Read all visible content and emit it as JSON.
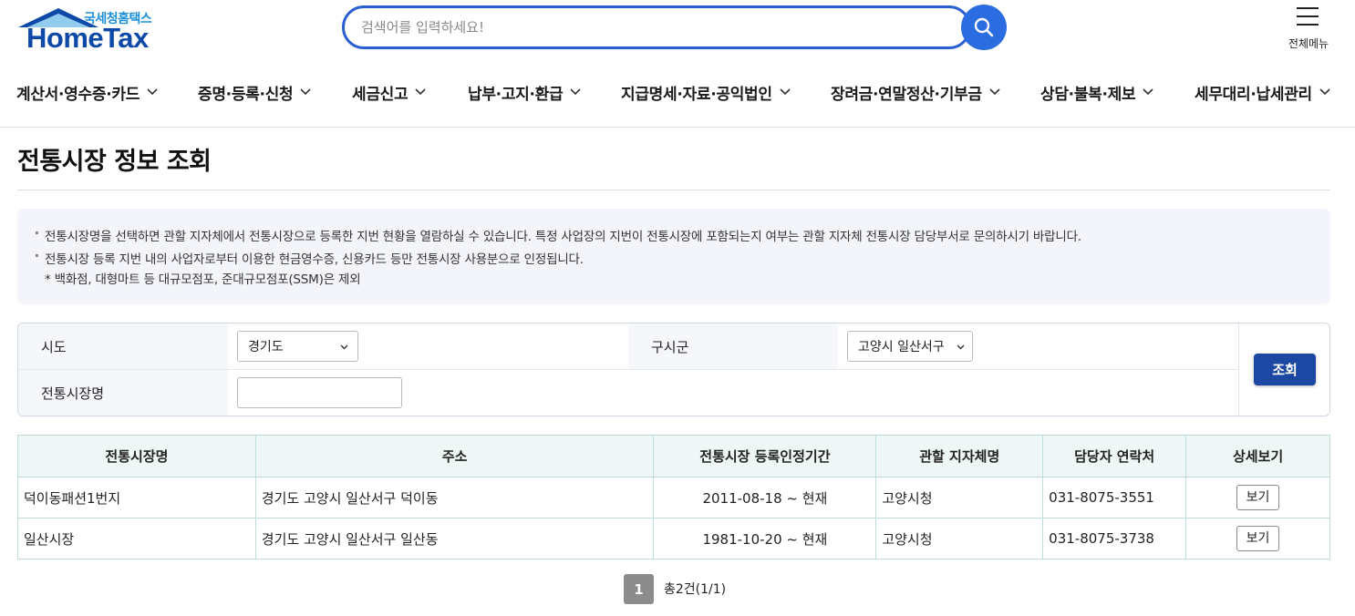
{
  "header": {
    "logo_sub": "국세청홈택스",
    "logo_main": "HomeTax",
    "search_placeholder": "검색어를 입력하세요!",
    "allmenu_label": "전체메뉴"
  },
  "gnb": [
    {
      "label": "계산서·영수증·카드"
    },
    {
      "label": "증명·등록·신청"
    },
    {
      "label": "세금신고"
    },
    {
      "label": "납부·고지·환급"
    },
    {
      "label": "지급명세·자료·공익법인"
    },
    {
      "label": "장려금·연말정산·기부금"
    },
    {
      "label": "상담·불복·제보"
    },
    {
      "label": "세무대리·납세관리"
    }
  ],
  "page": {
    "title": "전통시장 정보 조회"
  },
  "notice": {
    "line1": "전통시장명을 선택하면 관할 지자체에서 전통시장으로 등록한 지번 현황을 열람하실 수 있습니다. 특정 사업장의 지번이 전통시장에 포함되는지 여부는 관할 지자체 전통시장 담당부서로 문의하시기 바랍니다.",
    "line2": "전통시장 등록 지번 내의 사업자로부터 이용한 현금영수증, 신용카드 등만 전통시장 사용분으로 인정됩니다.",
    "line3": "* 백화점, 대형마트 등 대규모점포, 준대규모점포(SSM)은 제외"
  },
  "form": {
    "sido_label": "시도",
    "sido_value": "경기도",
    "gusigun_label": "구시군",
    "gusigun_value": "고양시 일산서구",
    "market_label": "전통시장명",
    "market_value": "",
    "search_button": "조회"
  },
  "table": {
    "headers": [
      "전통시장명",
      "주소",
      "전통시장 등록인정기간",
      "관할 지자체명",
      "담당자 연락처",
      "상세보기"
    ],
    "rows": [
      {
        "name": "덕이동패션1번지",
        "address": "경기도 고양시 일산서구 덕이동",
        "period": "2011-08-18 ~ 현재",
        "authority": "고양시청",
        "contact": "031-8075-3551",
        "view": "보기"
      },
      {
        "name": "일산시장",
        "address": "경기도 고양시 일산서구 일산동",
        "period": "1981-10-20 ~ 현재",
        "authority": "고양시청",
        "contact": "031-8075-3738",
        "view": "보기"
      }
    ]
  },
  "pagination": {
    "current": "1",
    "total_text": "총2건(1/1)"
  },
  "colors": {
    "brand": "#0d4aa8",
    "search_border": "#2b5fd0",
    "primary_button": "#1c47a3",
    "table_header_bg": "#eef6f6"
  },
  "icons": {
    "search": "search-icon",
    "menu": "hamburger-icon",
    "dropdown": "chevron-down-icon"
  }
}
